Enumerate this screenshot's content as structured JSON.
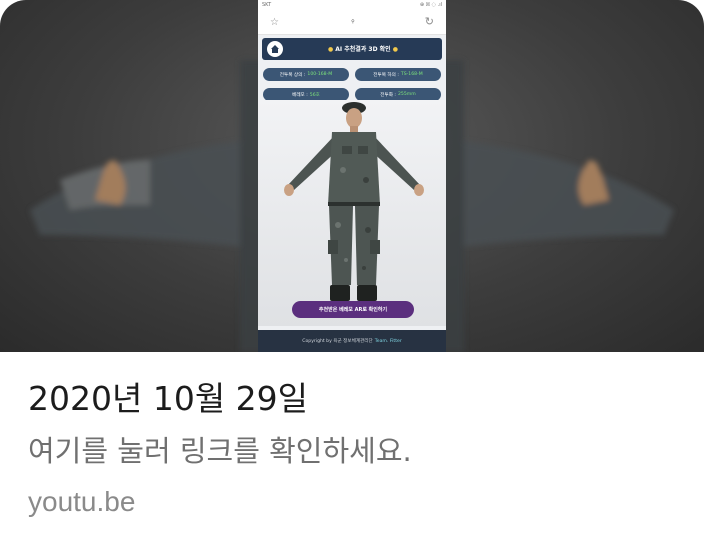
{
  "thumbnail": {
    "status_left": "SKT",
    "status_right": "⊕ ☒ ◌ .ıl",
    "url": "⚲",
    "app_title": "AI 추천결과 3D 확인",
    "chips": [
      {
        "label": "전투복 상의 :",
        "value": "100-168-M"
      },
      {
        "label": "전투복 하의 :",
        "value": "TS-168-M"
      },
      {
        "label": "베레모 :",
        "value": "56호"
      },
      {
        "label": "전투화 :",
        "value": "255mm"
      }
    ],
    "ar_button": "추천받은 베레모 AR로 확인하기",
    "copyright": "Copyright by 육군 정보체계관리단",
    "copyright_team": "Team. Fitter"
  },
  "link": {
    "title": "2020년 10월 29일",
    "description": "여기를 눌러 링크를 확인하세요.",
    "domain": "youtu.be"
  },
  "colors": {
    "header_bg": "#263a56",
    "chip_bg": "#3b5675",
    "chip_value": "#7ce17b",
    "ar_button_bg": "#5b2f7e",
    "title_text": "#1c1c1c",
    "description_text": "#707070",
    "domain_text": "#8a8a8a"
  },
  "icons": [
    "home-icon",
    "star-icon",
    "reload-icon"
  ]
}
